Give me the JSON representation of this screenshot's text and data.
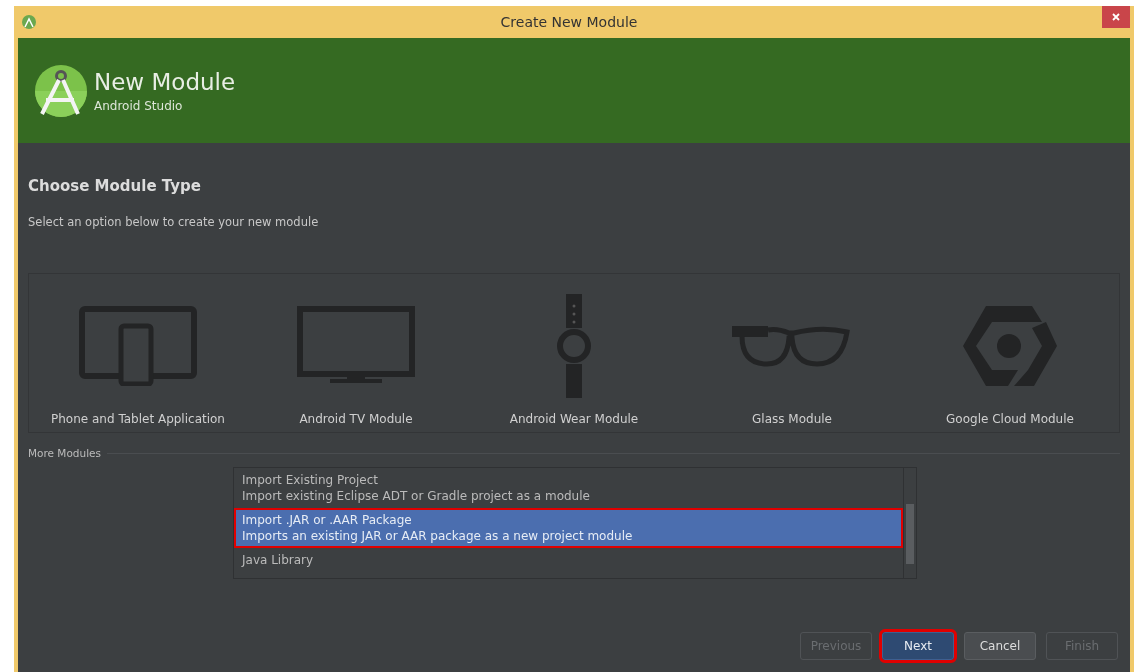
{
  "window": {
    "title": "Create New Module"
  },
  "header": {
    "title": "New Module",
    "subtitle": "Android Studio"
  },
  "page": {
    "heading": "Choose Module Type",
    "description": "Select an option below to create your new module"
  },
  "templates": [
    {
      "kind": "phone-tablet",
      "label": "Phone and Tablet Application"
    },
    {
      "kind": "tv",
      "label": "Android TV Module"
    },
    {
      "kind": "wear",
      "label": "Android Wear Module"
    },
    {
      "kind": "glass",
      "label": "Glass Module"
    },
    {
      "kind": "cloud",
      "label": "Google Cloud Module"
    }
  ],
  "more_modules": {
    "label": "More Modules",
    "items": [
      {
        "title": "Import Existing Project",
        "description": "Import existing Eclipse ADT or Gradle project as a module",
        "selected": false,
        "highlighted": false
      },
      {
        "title": "Import .JAR or .AAR Package",
        "description": "Imports an existing JAR or AAR package as a new project module",
        "selected": true,
        "highlighted": true
      },
      {
        "title": "Java Library",
        "selected": false,
        "highlighted": false
      }
    ]
  },
  "buttons": [
    {
      "label": "Previous",
      "disabled": true,
      "default": false,
      "highlighted": false
    },
    {
      "label": "Next",
      "disabled": false,
      "default": true,
      "highlighted": true
    },
    {
      "label": "Cancel",
      "disabled": false,
      "default": false,
      "highlighted": false
    },
    {
      "label": "Finish",
      "disabled": true,
      "default": false,
      "highlighted": false
    }
  ]
}
